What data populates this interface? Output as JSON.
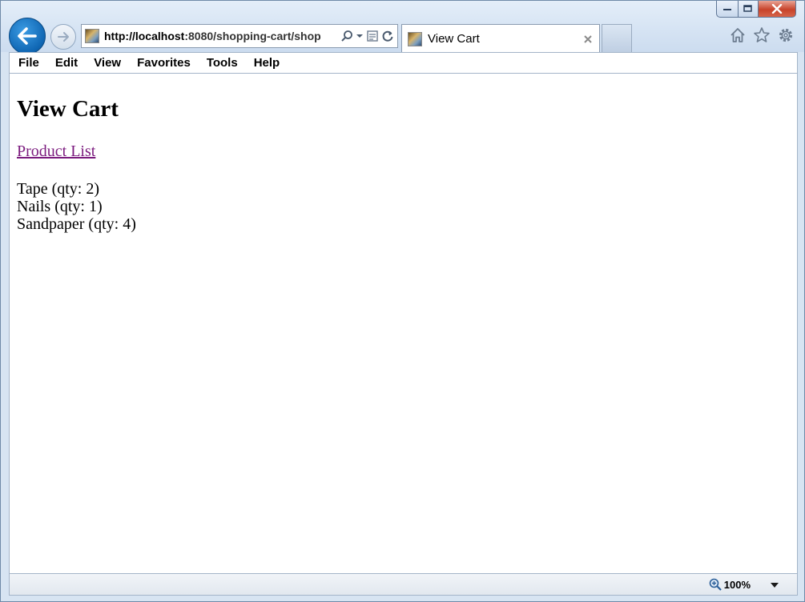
{
  "browser": {
    "address": {
      "url_host": "http://localhost",
      "url_path": ":8080/shopping-cart/shop"
    },
    "tab": {
      "title": "View Cart",
      "close_symbol": "✕"
    },
    "menu": [
      "File",
      "Edit",
      "View",
      "Favorites",
      "Tools",
      "Help"
    ],
    "status": {
      "zoom": "100%"
    },
    "accent_color": "#1173c4"
  },
  "page": {
    "title": "View Cart",
    "link": "Product List",
    "link_color": "#7b1b7e",
    "items": [
      "Tape (qty: 2)",
      "Nails (qty: 1)",
      "Sandpaper (qty: 4)"
    ]
  },
  "icons": [
    "back-arrow-icon",
    "forward-arrow-icon",
    "search-icon",
    "compatibility-view-icon",
    "refresh-icon",
    "home-icon",
    "favorites-star-icon",
    "gear-icon",
    "zoom-icon"
  ]
}
